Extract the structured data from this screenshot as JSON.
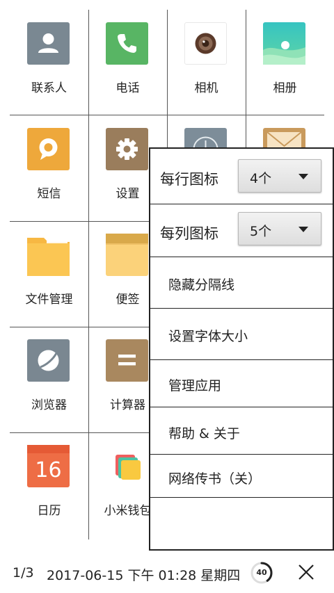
{
  "apps": [
    {
      "label": "联系人",
      "icon": "contacts-icon"
    },
    {
      "label": "电话",
      "icon": "phone-icon"
    },
    {
      "label": "相机",
      "icon": "camera-icon"
    },
    {
      "label": "相册",
      "icon": "gallery-icon"
    },
    {
      "label": "短信",
      "icon": "message-icon"
    },
    {
      "label": "设置",
      "icon": "gear-icon"
    },
    {
      "label": "",
      "icon": "clock-icon"
    },
    {
      "label": "",
      "icon": "mail-icon"
    },
    {
      "label": "文件管理",
      "icon": "folder-icon"
    },
    {
      "label": "便签",
      "icon": "notes-icon"
    },
    {
      "label": "",
      "icon": ""
    },
    {
      "label": "",
      "icon": ""
    },
    {
      "label": "浏览器",
      "icon": "browser-icon"
    },
    {
      "label": "计算器",
      "icon": "calculator-icon"
    },
    {
      "label": "",
      "icon": ""
    },
    {
      "label": "",
      "icon": ""
    },
    {
      "label": "日历",
      "icon": "calendar-icon",
      "day": "16"
    },
    {
      "label": "小米钱包",
      "icon": "wallet-icon"
    }
  ],
  "menu": {
    "icons_per_row": {
      "label": "每行图标",
      "value": "4个"
    },
    "icons_per_column": {
      "label": "每列图标",
      "value": "5个"
    },
    "items": [
      {
        "label": "隐藏分隔线"
      },
      {
        "label": "设置字体大小"
      },
      {
        "label": "管理应用"
      },
      {
        "label": "帮助 & 关于"
      },
      {
        "label": "网络传书（关）"
      }
    ]
  },
  "status": {
    "page": "1/3",
    "datetime": "2017-06-15 下午 01:28 星期四",
    "battery": "40",
    "battery_level": 0.4
  },
  "colors": {
    "border": "#222222",
    "grid_line": "#555555"
  }
}
